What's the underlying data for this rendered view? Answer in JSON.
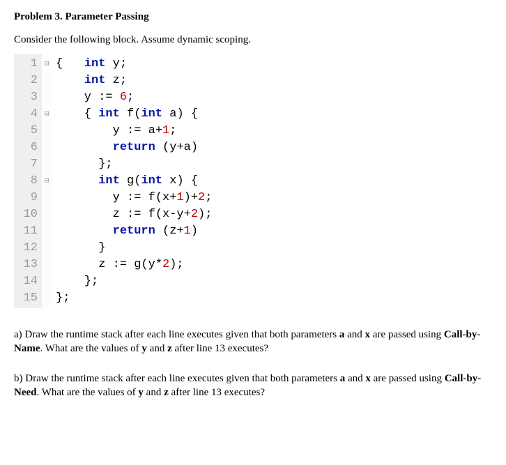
{
  "title": "Problem 3. Parameter Passing",
  "intro": "Consider the following block. Assume dynamic scoping.",
  "code": {
    "gutter": [
      "1",
      "2",
      "3",
      "4",
      "5",
      "6",
      "7",
      "8",
      "9",
      "10",
      "11",
      "12",
      "13",
      "14",
      "15"
    ],
    "fold": [
      "⊟",
      "",
      "",
      "⊟",
      "",
      "",
      "",
      "⊟",
      "",
      "",
      "",
      "",
      "",
      "",
      ""
    ],
    "lines": [
      [
        {
          "t": "{   ",
          "c": "plain"
        },
        {
          "t": "int",
          "c": "kw"
        },
        {
          "t": " y;",
          "c": "plain"
        }
      ],
      [
        {
          "t": "    ",
          "c": "plain"
        },
        {
          "t": "int",
          "c": "kw"
        },
        {
          "t": " z;",
          "c": "plain"
        }
      ],
      [
        {
          "t": "    y := ",
          "c": "plain"
        },
        {
          "t": "6",
          "c": "num"
        },
        {
          "t": ";",
          "c": "plain"
        }
      ],
      [
        {
          "t": "    { ",
          "c": "plain"
        },
        {
          "t": "int",
          "c": "kw"
        },
        {
          "t": " f(",
          "c": "plain"
        },
        {
          "t": "int",
          "c": "kw"
        },
        {
          "t": " a) {",
          "c": "plain"
        }
      ],
      [
        {
          "t": "        y := a+",
          "c": "plain"
        },
        {
          "t": "1",
          "c": "num"
        },
        {
          "t": ";",
          "c": "plain"
        }
      ],
      [
        {
          "t": "        ",
          "c": "plain"
        },
        {
          "t": "return",
          "c": "kw"
        },
        {
          "t": " (y+a)",
          "c": "plain"
        }
      ],
      [
        {
          "t": "      };",
          "c": "plain"
        }
      ],
      [
        {
          "t": "      ",
          "c": "plain"
        },
        {
          "t": "int",
          "c": "kw"
        },
        {
          "t": " g(",
          "c": "plain"
        },
        {
          "t": "int",
          "c": "kw"
        },
        {
          "t": " x) {",
          "c": "plain"
        }
      ],
      [
        {
          "t": "        y := f(x+",
          "c": "plain"
        },
        {
          "t": "1",
          "c": "num"
        },
        {
          "t": ")+",
          "c": "plain"
        },
        {
          "t": "2",
          "c": "num"
        },
        {
          "t": ";",
          "c": "plain"
        }
      ],
      [
        {
          "t": "        z := f(x-y+",
          "c": "plain"
        },
        {
          "t": "2",
          "c": "num"
        },
        {
          "t": ");",
          "c": "plain"
        }
      ],
      [
        {
          "t": "        ",
          "c": "plain"
        },
        {
          "t": "return",
          "c": "kw"
        },
        {
          "t": " (z+",
          "c": "plain"
        },
        {
          "t": "1",
          "c": "num"
        },
        {
          "t": ")",
          "c": "plain"
        }
      ],
      [
        {
          "t": "      }",
          "c": "plain"
        }
      ],
      [
        {
          "t": "      z := g(y*",
          "c": "plain"
        },
        {
          "t": "2",
          "c": "num"
        },
        {
          "t": ");",
          "c": "plain"
        }
      ],
      [
        {
          "t": "    };",
          "c": "plain"
        }
      ],
      [
        {
          "t": "};",
          "c": "plain"
        }
      ]
    ]
  },
  "qa": {
    "prefix": "a)  Draw the runtime stack after each line executes given that both parameters ",
    "bold1": "a",
    "mid1": " and ",
    "bold2": "x",
    "mid2": " are passed using ",
    "method": "Call-by-Name",
    "suffix": ".   What are the values of ",
    "bold3": "y",
    "mid3": " and ",
    "bold4": "z",
    "end": " after line 13 executes?"
  },
  "qb": {
    "prefix": "b)  Draw the runtime stack after each line executes given that both parameters ",
    "bold1": "a",
    "mid1": " and ",
    "bold2": "x",
    "mid2": " are passed using ",
    "method": "Call-by-Need",
    "suffix": ".   What are the values of ",
    "bold3": "y",
    "mid3": " and ",
    "bold4": "z",
    "end": " after line 13 executes?"
  }
}
